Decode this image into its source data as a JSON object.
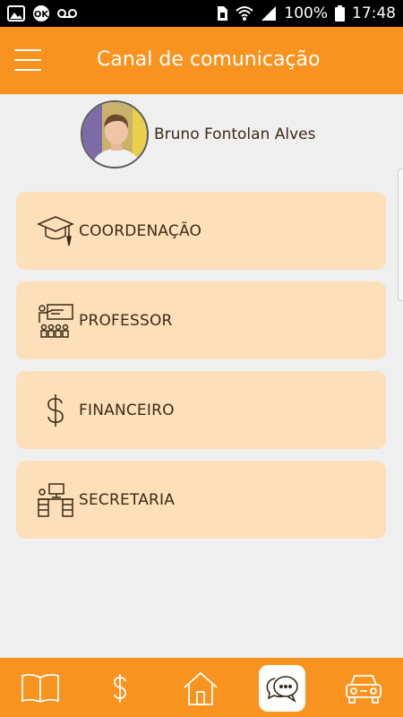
{
  "status_bar": {
    "battery": "100%",
    "time": "17:48",
    "left_icons": [
      "image-icon",
      "ok-badge-icon",
      "voicemail-icon"
    ],
    "right_icons": [
      "sim-icon",
      "wifi-icon",
      "signal-icon",
      "battery-icon"
    ]
  },
  "app_bar": {
    "title": "Canal de comunicação",
    "menu_icon": "hamburger-menu-icon"
  },
  "profile": {
    "name": "Bruno Fontolan Alves"
  },
  "channels": [
    {
      "label": "COORDENAÇÃO",
      "icon": "graduation-cap-icon"
    },
    {
      "label": "PROFESSOR",
      "icon": "teacher-board-icon"
    },
    {
      "label": "FINANCEIRO",
      "icon": "dollar-icon"
    },
    {
      "label": "SECRETARIA",
      "icon": "secretary-desk-icon"
    }
  ],
  "bottom_nav": {
    "items": [
      "book-icon",
      "dollar-icon",
      "home-icon",
      "chat-icon",
      "car-icon"
    ],
    "active": "chat-icon"
  },
  "colors": {
    "primary": "#f7931e",
    "card": "#fde0b9",
    "text": "#3b2a17",
    "background": "#efefef"
  }
}
